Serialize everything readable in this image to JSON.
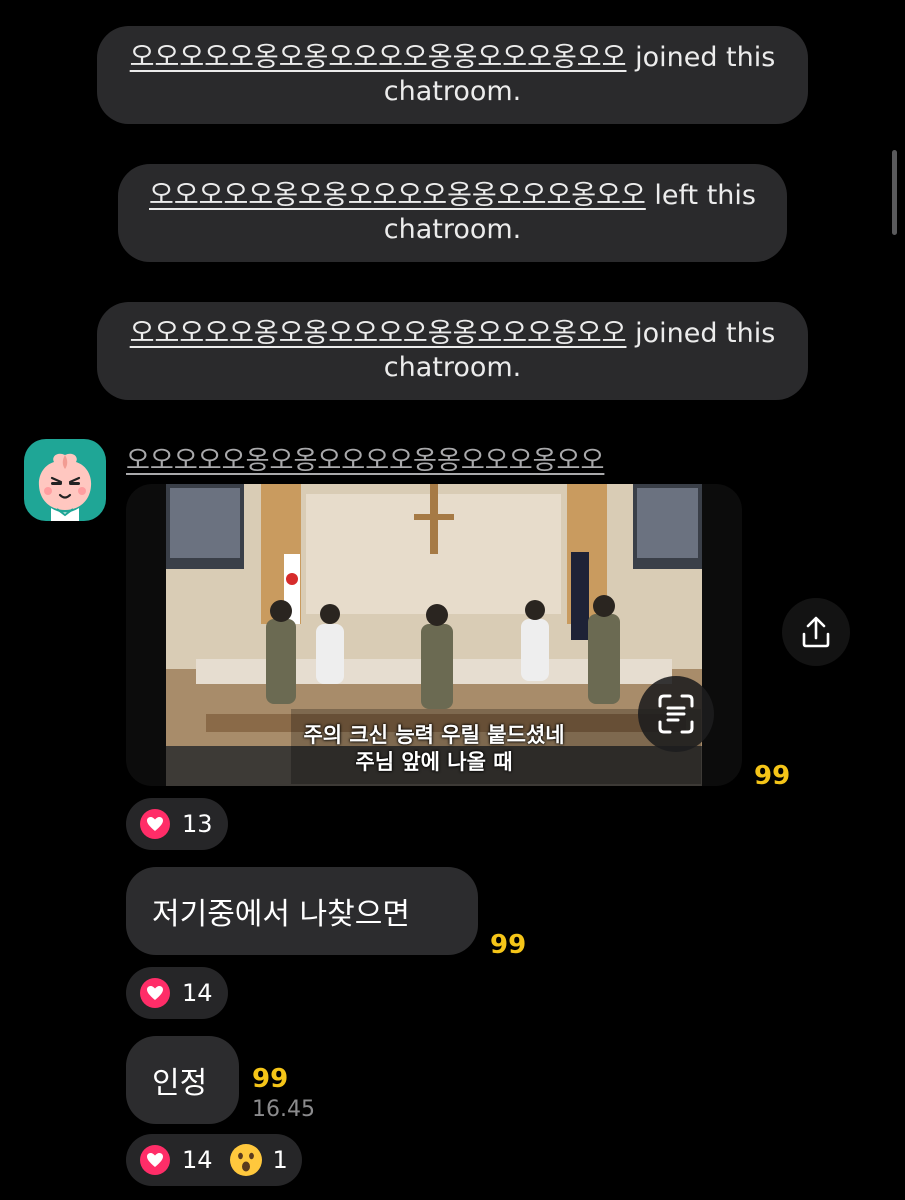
{
  "system_messages": [
    {
      "nickname": "오오오오오옹오옹오오오오옹옹오오오옹오오",
      "action": " joined this chatroom."
    },
    {
      "nickname": "오오오오오옹오옹오오오오옹옹오오오옹오오",
      "action": " left this chatroom."
    },
    {
      "nickname": "오오오오오옹오옹오오오오옹옹오오오옹오오",
      "action": " joined this chatroom."
    }
  ],
  "video_message": {
    "sender": "오오오오오옹오옹오오오오옹옹오오오옹오오",
    "subtitle_line1": "주의 크신 능력 우릴 붙드셨네",
    "subtitle_line2": "주님 앞에 나올 때",
    "unread_count": "99",
    "reactions": {
      "heart_count": "13"
    }
  },
  "messages": [
    {
      "text": "저기중에서 나찾으면",
      "unread_count": "99",
      "reactions": {
        "heart_count": "14"
      }
    },
    {
      "text": "인정",
      "unread_count": "99",
      "time": "16.45",
      "reactions": {
        "heart_count": "14",
        "wow_count": "1"
      }
    }
  ],
  "colors": {
    "background": "#000000",
    "bubble": "#2c2c2e",
    "unread": "#f5c518",
    "heart": "#ff2d68",
    "avatar_bg": "#1fa696"
  },
  "icons": [
    "avatar-peach",
    "share-icon",
    "text-scan-icon",
    "heart-icon",
    "surprised-face-icon"
  ]
}
